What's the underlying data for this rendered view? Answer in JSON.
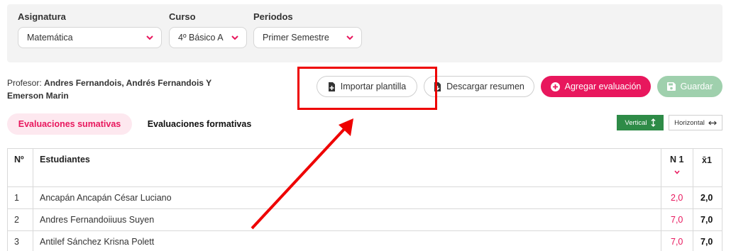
{
  "filters": {
    "subject": {
      "label": "Asignatura",
      "value": "Matemática"
    },
    "course": {
      "label": "Curso",
      "value": "4º Básico A"
    },
    "period": {
      "label": "Periodos",
      "value": "Primer Semestre"
    }
  },
  "professor": {
    "prefix": "Profesor: ",
    "names": "Andres Fernandois, Andrés Fernandois Y Emerson Marin"
  },
  "toolbar": {
    "import_label": "Importar plantilla",
    "download_label": "Descargar resumen",
    "add_label": "Agregar evaluación",
    "save_label": "Guardar"
  },
  "tabs": {
    "summative": "Evaluaciones sumativas",
    "formative": "Evaluaciones formativas"
  },
  "view_toggle": {
    "vertical": "Vertical",
    "horizontal": "Horizontal"
  },
  "table": {
    "headers": {
      "num": "Nº",
      "students": "Estudiantes",
      "n1": "N 1",
      "avg": "x̄1"
    },
    "rows": [
      {
        "num": "1",
        "name": "Ancapán Ancapán César Luciano",
        "n1": "2,0",
        "avg": "2,0"
      },
      {
        "num": "2",
        "name": "Andres Fernandoiiuus Suyen",
        "n1": "7,0",
        "avg": "7,0"
      },
      {
        "num": "3",
        "name": "Antilef Sánchez Krisna Polett",
        "n1": "7,0",
        "avg": "7,0"
      }
    ]
  },
  "colors": {
    "accent": "#e8175d",
    "green": "#2e8b47",
    "annotation": "#ee0000"
  }
}
